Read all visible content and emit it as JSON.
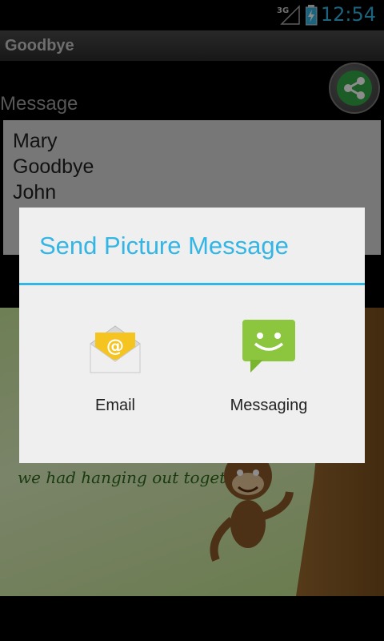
{
  "status_bar": {
    "network": "3G",
    "time": "12:54"
  },
  "app_bar": {
    "title": "Goodbye"
  },
  "screen": {
    "message_label": "Message",
    "message_lines": [
      "Mary",
      "Goodbye",
      "John"
    ],
    "card_text": "we had hanging out together!"
  },
  "dialog": {
    "title": "Send Picture Message",
    "options": [
      {
        "label": "Email",
        "icon": "email-icon"
      },
      {
        "label": "Messaging",
        "icon": "messaging-icon"
      }
    ],
    "accent": "#33b5e5"
  }
}
